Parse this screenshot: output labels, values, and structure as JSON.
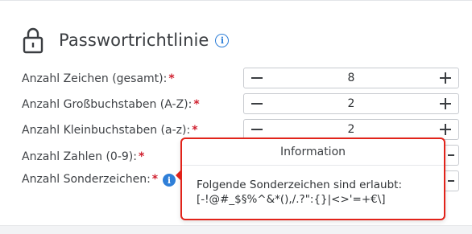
{
  "header": {
    "title": "Passwortrichtlinie",
    "lock_icon": "lock-icon",
    "info_icon": "info-circle-icon"
  },
  "rows": [
    {
      "label": "Anzahl Zeichen (gesamt):",
      "required": "*",
      "value": "8"
    },
    {
      "label": "Anzahl Großbuchstaben (A-Z):",
      "required": "*",
      "value": "2"
    },
    {
      "label": "Anzahl Kleinbuchstaben (a-z):",
      "required": "*",
      "value": "2"
    },
    {
      "label": "Anzahl Zahlen (0-9):",
      "required": "*"
    },
    {
      "label": "Anzahl Sonderzeichen:",
      "required": "*"
    }
  ],
  "popover": {
    "title": "Information",
    "line1": "Folgende Sonderzeichen sind erlaubt:",
    "line2": "[-!@#_$§%^&*(),/.?\":{}|<>'=+€\\]"
  },
  "colors": {
    "accent": "#2f7fd8",
    "required": "#d0202f",
    "highlight_border": "#e2231a"
  }
}
